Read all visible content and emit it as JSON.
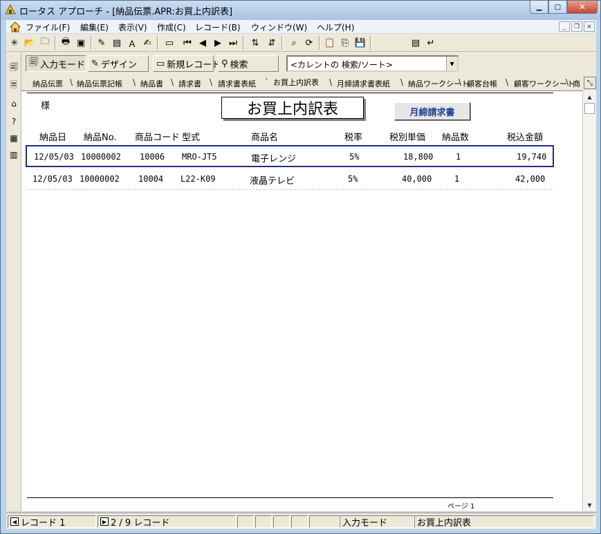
{
  "window": {
    "title": "ロータス アプローチ - [納品伝票.APR:お買上内訳表]"
  },
  "menu": {
    "items": [
      "ファイル(F)",
      "編集(E)",
      "表示(V)",
      "作成(C)",
      "レコード(B)",
      "ウィンドウ(W)",
      "ヘルプ(H)"
    ]
  },
  "actions": {
    "input_mode": "入力モード",
    "design": "デザイン",
    "new_record": "新規レコード",
    "search": "検索",
    "combo_value": "<カレントの 検索/ソート>"
  },
  "tabs": [
    "納品伝票",
    "納品伝票記帳",
    "納品書",
    "請求書",
    "請求書表紙",
    "お買上内訳表",
    "月締請求書表紙",
    "納品ワークシート",
    "顧客台帳",
    "顧客ワークシート",
    "商"
  ],
  "active_tab_index": 5,
  "report": {
    "sama": "様",
    "title": "お買上内訳表",
    "monthly_button": "月締請求書",
    "columns": [
      "納品日",
      "納品No.",
      "商品コード",
      "型式",
      "商品名",
      "税率",
      "税別単価",
      "納品数",
      "税込金額"
    ],
    "rows": [
      [
        "12/05/03",
        "10000002",
        "10006",
        "MRO-JT5",
        "電子レンジ",
        "5%",
        "18,800",
        "1",
        "19,740"
      ],
      [
        "12/05/03",
        "10000002",
        "10004",
        "L22-K09",
        "液晶テレビ",
        "5%",
        "40,000",
        "1",
        "42,000"
      ]
    ],
    "selected_row": 0,
    "page_label": "ページ 1"
  },
  "status": {
    "record_label": "レコード 1",
    "record_count": "2 / 9 レコード",
    "mode": "入力モード",
    "view": "お買上内訳表"
  }
}
